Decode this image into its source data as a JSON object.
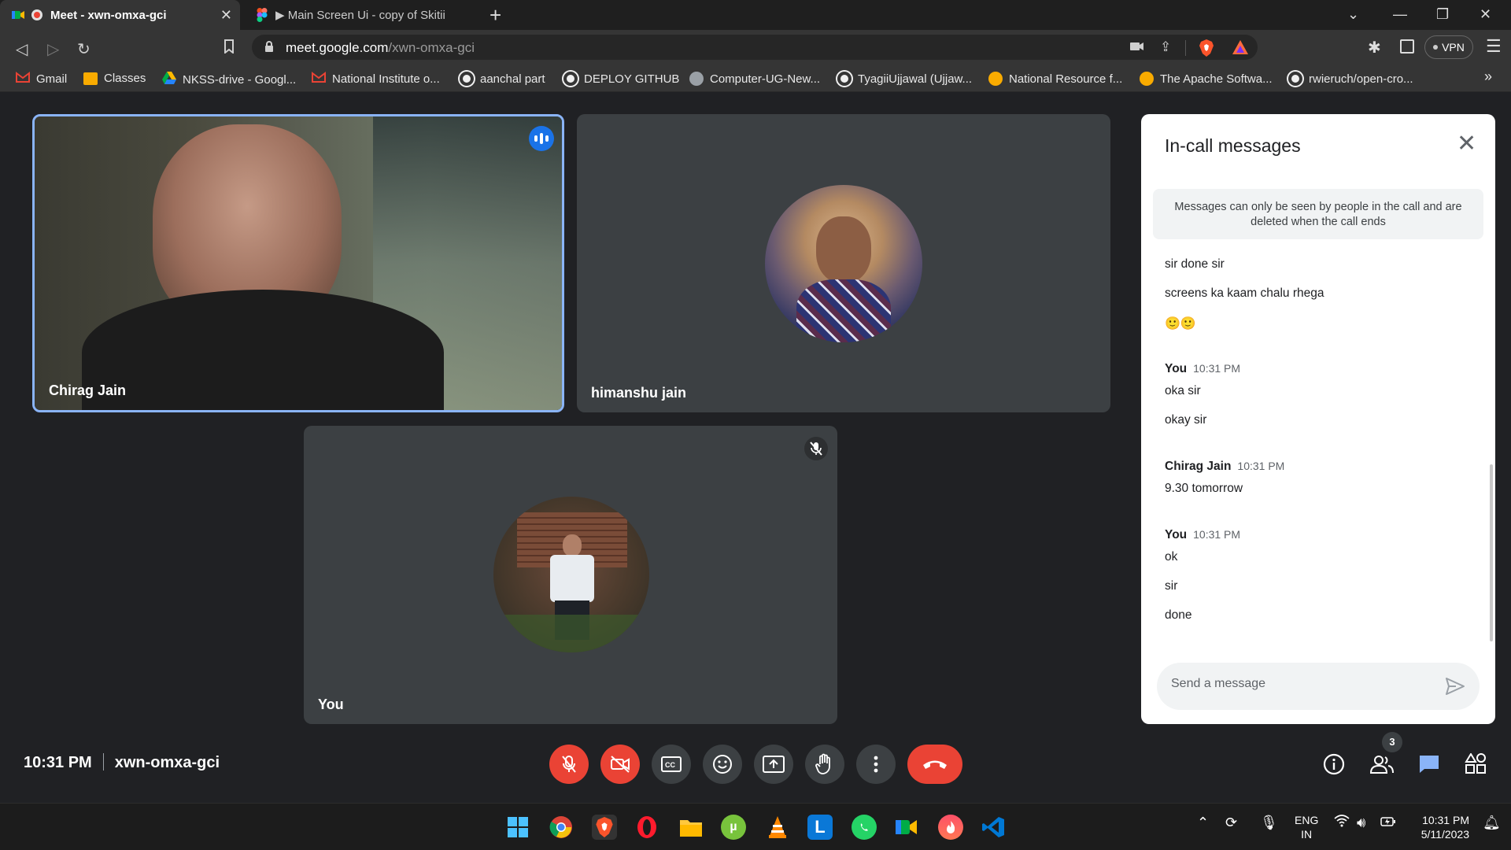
{
  "browser": {
    "tabs": [
      {
        "title": "Meet - xwn-omxa-gci",
        "active": true
      },
      {
        "title": "▶ Main Screen Ui - copy of Skitii",
        "active": false
      }
    ],
    "url_host": "meet.google.com",
    "url_path": "/xwn-omxa-gci",
    "vpn_label": "VPN",
    "bookmarks": [
      {
        "label": "Gmail",
        "icon": "gmail-icon"
      },
      {
        "label": "Classes",
        "icon": "classroom-icon"
      },
      {
        "label": "NKSS-drive - Googl...",
        "icon": "drive-icon"
      },
      {
        "label": "National Institute o...",
        "icon": "gmail-icon"
      },
      {
        "label": "aanchal part",
        "icon": "github-icon"
      },
      {
        "label": "DEPLOY GITHUB",
        "icon": "github-icon"
      },
      {
        "label": "Computer-UG-New...",
        "icon": "globe-icon"
      },
      {
        "label": "TyagiiUjjawal (Ujjaw...",
        "icon": "github-icon"
      },
      {
        "label": "National Resource f...",
        "icon": "code-icon"
      },
      {
        "label": "The Apache Softwa...",
        "icon": "code-icon"
      },
      {
        "label": "rwieruch/open-cro...",
        "icon": "github-icon"
      }
    ],
    "more_bookmarks": "»"
  },
  "participants": {
    "tile1_name": "Chirag Jain",
    "tile2_name": "himanshu jain",
    "tile3_name": "You"
  },
  "chat": {
    "title": "In-call messages",
    "notice": "Messages can only be seen by people in the call and are deleted when the call ends",
    "messages": {
      "m1": "sir done sir",
      "m2": "screens ka kaam chalu rhega",
      "m3": "🙂🙂",
      "s1_name": "You",
      "s1_time": "10:31 PM",
      "m4": "oka sir",
      "m5": "okay sir",
      "s2_name": "Chirag Jain",
      "s2_time": "10:31 PM",
      "m6": "9.30 tomorrow",
      "s3_name": "You",
      "s3_time": "10:31 PM",
      "m7": "ok",
      "m8": "sir",
      "m9": "done"
    },
    "input_placeholder": "Send a message"
  },
  "meeting": {
    "time": "10:31 PM",
    "code": "xwn-omxa-gci",
    "people_count": "3"
  },
  "taskbar": {
    "lang_line1": "ENG",
    "lang_line2": "IN",
    "clock_time": "10:31 PM",
    "clock_date": "5/11/2023"
  },
  "colors": {
    "meet_bg": "#202124",
    "tile_bg": "#3c4043",
    "danger_red": "#ea4335",
    "active_speaker_blue": "#8ab4f8",
    "speaking_indicator": "#1a73e8"
  }
}
